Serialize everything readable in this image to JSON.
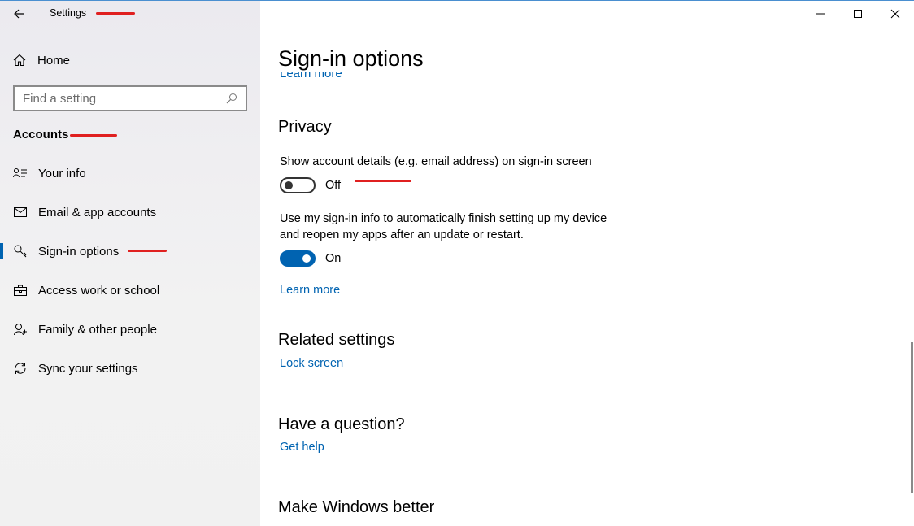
{
  "window": {
    "title": "Settings"
  },
  "sidebar": {
    "home_label": "Home",
    "search_placeholder": "Find a setting",
    "section_title": "Accounts",
    "items": [
      {
        "label": "Your info",
        "icon": "person-card-icon"
      },
      {
        "label": "Email & app accounts",
        "icon": "mail-icon"
      },
      {
        "label": "Sign-in options",
        "icon": "key-icon",
        "selected": true
      },
      {
        "label": "Access work or school",
        "icon": "briefcase-icon"
      },
      {
        "label": "Family & other people",
        "icon": "person-add-icon"
      },
      {
        "label": "Sync your settings",
        "icon": "sync-icon"
      }
    ]
  },
  "main": {
    "page_title": "Sign-in options",
    "clipped_link": "Learn more",
    "privacy": {
      "heading": "Privacy",
      "setting1_text": "Show account details (e.g. email address) on sign-in screen",
      "setting1_state": "Off",
      "setting2_text_line1": "Use my sign-in info to automatically finish setting up my device",
      "setting2_text_line2": "and reopen my apps after an update or restart.",
      "setting2_state": "On",
      "learn_more": "Learn more"
    },
    "related": {
      "heading": "Related settings",
      "link": "Lock screen"
    },
    "question": {
      "heading": "Have a question?",
      "link": "Get help"
    },
    "better": {
      "heading": "Make Windows better"
    }
  },
  "colors": {
    "accent": "#0063b1",
    "annotation_mark": "#e02020",
    "sidebar_bg": "#f1f1f1"
  }
}
